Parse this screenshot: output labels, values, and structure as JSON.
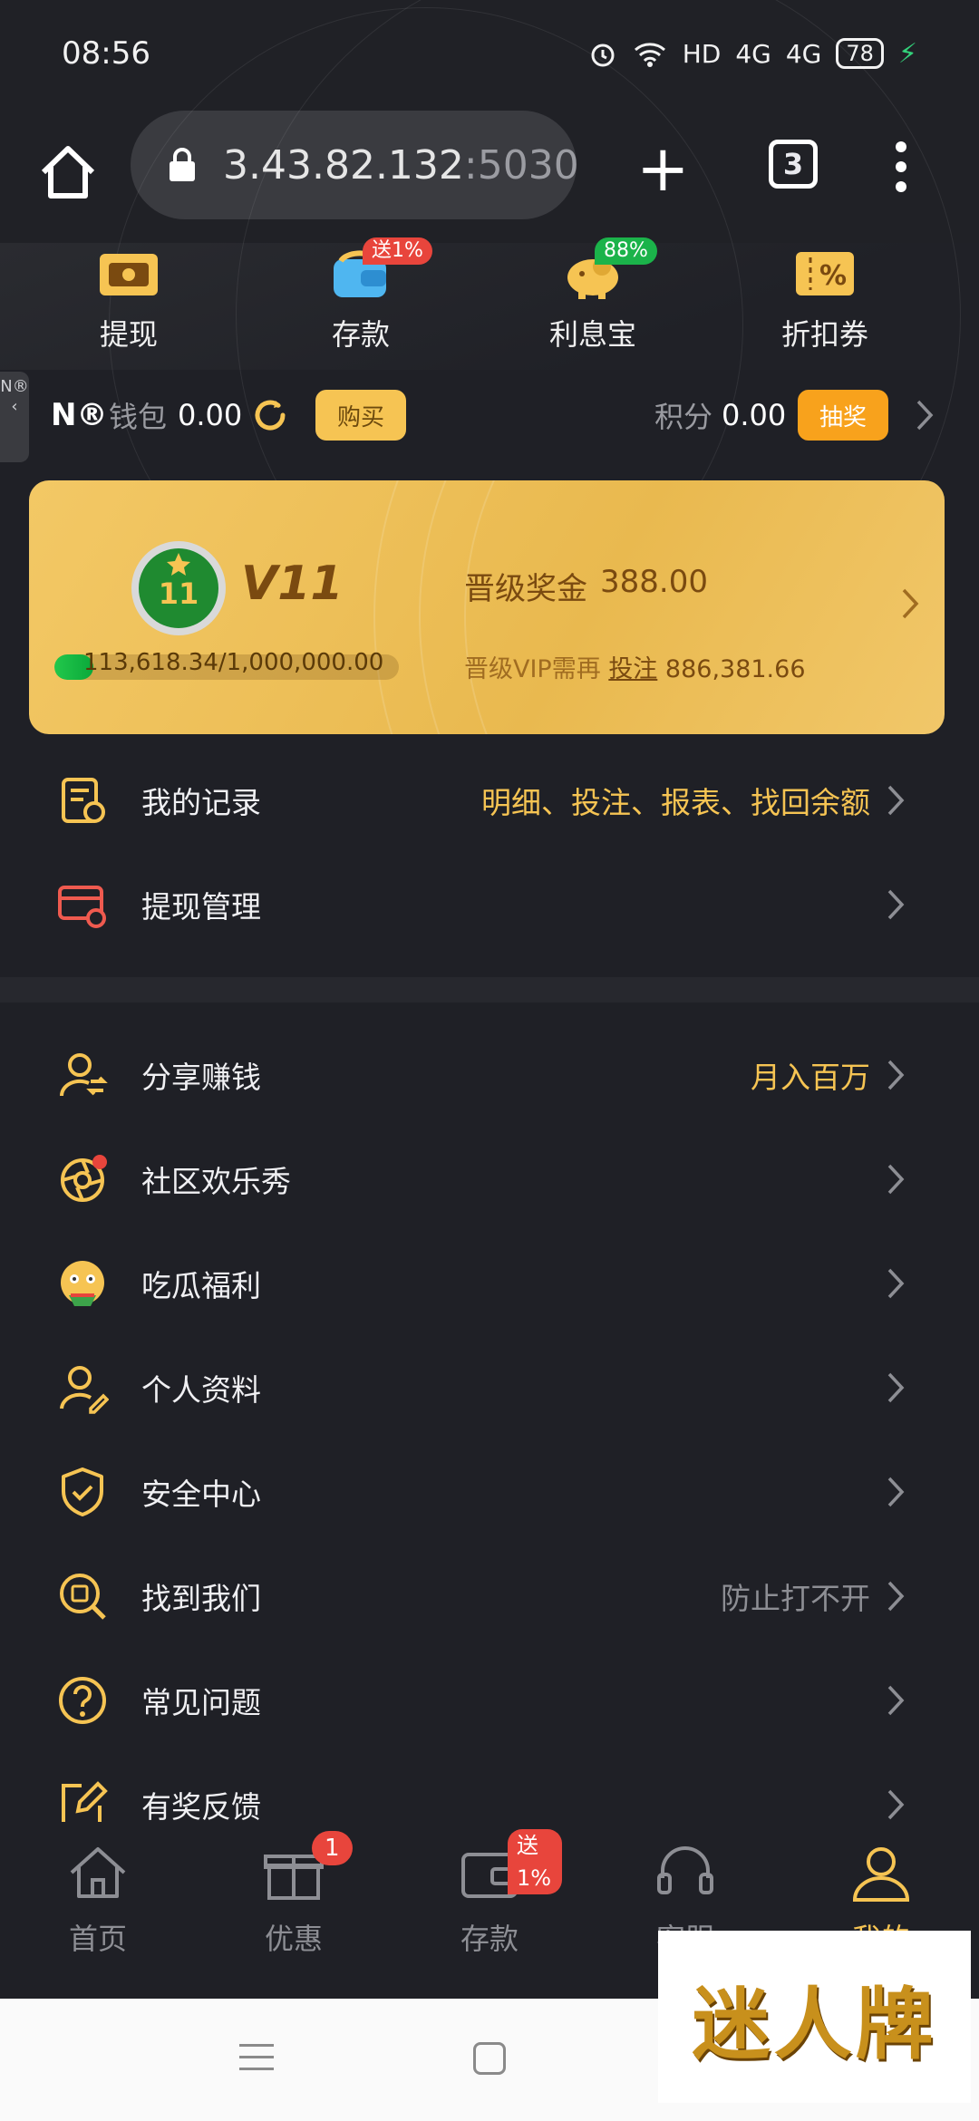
{
  "status_bar": {
    "time": "08:56",
    "network": "HD",
    "signal_1": "4G",
    "signal_2": "4G",
    "battery": "78"
  },
  "browser": {
    "url_host": "3.43.82.132",
    "url_port": ":5030",
    "tab_count": "3"
  },
  "quick_actions": [
    {
      "label": "提现",
      "icon": "withdraw-card-icon"
    },
    {
      "label": "存款",
      "icon": "deposit-wallet-icon",
      "badge": "送1%"
    },
    {
      "label": "利息宝",
      "icon": "piggy-bank-icon",
      "badge": "88%"
    },
    {
      "label": "折扣券",
      "icon": "coupon-icon"
    }
  ],
  "side_tab": {
    "text": "N®"
  },
  "wallet": {
    "nb_logo": "N®",
    "label": "钱包",
    "value": "0.00",
    "buy_label": "购买",
    "points_label": "积分",
    "points_value": "0.00",
    "draw_label": "抽奖"
  },
  "vip": {
    "medal_number": "11",
    "level": "V11",
    "progress_text": "113,618.34/1,000,000.00",
    "progress_fraction": 0.1136,
    "bonus_label": "晋级奖金",
    "bonus_value": "388.00",
    "need_prefix": "晋级VIP需再",
    "need_link": "投注",
    "need_amount": "886,381.66"
  },
  "menu_group_1": [
    {
      "label": "我的记录",
      "hint": "明细、投注、报表、找回余额",
      "hint_color": "#f6c453",
      "icon": "records-icon"
    },
    {
      "label": "提现管理",
      "hint": "",
      "hint_color": "#f6c453",
      "icon": "withdraw-manage-icon"
    }
  ],
  "menu_group_2": [
    {
      "label": "分享赚钱",
      "hint": "月入百万",
      "hint_color": "#f6c453",
      "icon": "share-earn-icon"
    },
    {
      "label": "社区欢乐秀",
      "hint": "",
      "hint_color": "#f6c453",
      "icon": "community-camera-icon"
    },
    {
      "label": "吃瓜福利",
      "hint": "",
      "hint_color": "#f6c453",
      "icon": "melon-emoji-icon"
    },
    {
      "label": "个人资料",
      "hint": "",
      "hint_color": "#f6c453",
      "icon": "profile-icon"
    },
    {
      "label": "安全中心",
      "hint": "",
      "hint_color": "#f6c453",
      "icon": "shield-icon"
    },
    {
      "label": "找到我们",
      "hint": "防止打不开",
      "hint_color": "#8d8e94",
      "icon": "find-us-icon"
    },
    {
      "label": "常见问题",
      "hint": "",
      "hint_color": "#f6c453",
      "icon": "question-icon"
    },
    {
      "label": "有奖反馈",
      "hint": "",
      "hint_color": "#f6c453",
      "icon": "feedback-icon"
    }
  ],
  "bottom_nav": [
    {
      "label": "首页",
      "icon": "home-icon"
    },
    {
      "label": "优惠",
      "icon": "gift-icon",
      "badge": "1"
    },
    {
      "label": "存款",
      "icon": "wallet-icon",
      "badge": "送1%"
    },
    {
      "label": "客服",
      "icon": "headset-icon"
    },
    {
      "label": "我的",
      "icon": "user-icon",
      "active": true
    }
  ],
  "watermark": "迷人牌",
  "colors": {
    "accent": "#f6c453",
    "background": "#1f2026",
    "badge_red": "#e8453c",
    "badge_green": "#1bb34a"
  }
}
